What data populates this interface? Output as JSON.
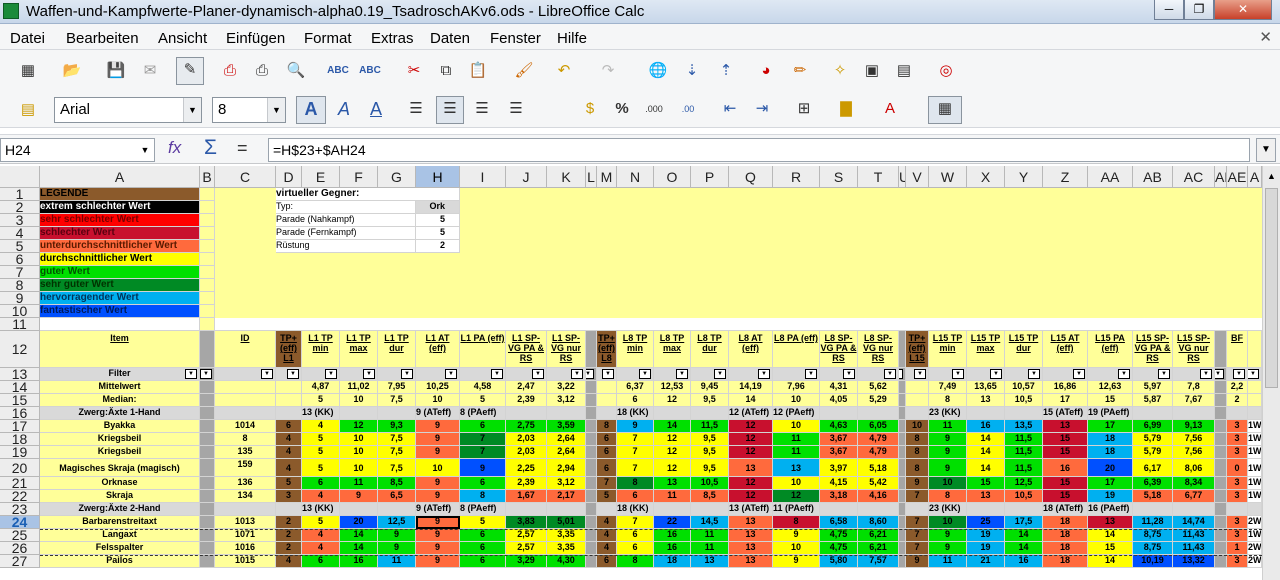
{
  "window": {
    "title": "Waffen-und-Kampfwerte-Planer-dynamisch-alpha0.19_TsadroschAKv6.ods - LibreOffice Calc",
    "min": "─",
    "max": "❐",
    "close": "✕"
  },
  "menu": [
    "Datei",
    "Bearbeiten",
    "Ansicht",
    "Einfügen",
    "Format",
    "Extras",
    "Daten",
    "Fenster",
    "Hilfe"
  ],
  "menu_close": "✕",
  "toolbar1_icons": [
    "new-icon",
    "open-icon",
    "save-icon",
    "email-icon",
    "edit-mode-icon",
    "pdf-icon",
    "print-icon",
    "print-preview-icon",
    "spellcheck-icon",
    "autospell-icon",
    "cut-icon",
    "copy-icon",
    "paste-icon",
    "clone-format-icon",
    "undo-icon",
    "redo-icon",
    "hyperlink-icon",
    "sort-ascending-icon",
    "sort-descending-icon",
    "chart-icon",
    "draw-icon",
    "navigator-icon",
    "gallery-icon",
    "datasource-icon",
    "help-icon"
  ],
  "fmt": {
    "font": "Arial",
    "size": "8"
  },
  "formula": {
    "cell": "H24",
    "content": "=H$23+$AH24"
  },
  "col_headers": [
    "A",
    "B",
    "C",
    "D",
    "E",
    "F",
    "G",
    "H",
    "I",
    "J",
    "K",
    "L",
    "M",
    "N",
    "O",
    "P",
    "Q",
    "R",
    "S",
    "T",
    "U",
    "V",
    "W",
    "X",
    "Y",
    "Z",
    "AA",
    "AB",
    "AC",
    "AD",
    "AE",
    "A"
  ],
  "row_numbers": [
    "1",
    "2",
    "3",
    "4",
    "5",
    "6",
    "7",
    "8",
    "9",
    "10",
    "11",
    "12",
    "13",
    "14",
    "15",
    "16",
    "17",
    "18",
    "19",
    "20",
    "21",
    "22",
    "23",
    "24",
    "25",
    "26",
    "27"
  ],
  "legend": {
    "title": "LEGENDE",
    "items": [
      {
        "label": "extrem schlechter Wert",
        "bg": "#000000",
        "fg": "#ffffff"
      },
      {
        "label": "sehr schlechter Wert",
        "bg": "#ff0000",
        "fg": "#7a0000"
      },
      {
        "label": "schlechter Wert",
        "bg": "#c8102e",
        "fg": "#5a0010"
      },
      {
        "label": "unterdurchschnittlicher Wert",
        "bg": "#ff6a3d",
        "fg": "#5a1a00"
      },
      {
        "label": "durchschnittlicher Wert",
        "bg": "#ffff00",
        "fg": "#000000"
      },
      {
        "label": "guter Wert",
        "bg": "#00e000",
        "fg": "#005500"
      },
      {
        "label": "sehr guter Wert",
        "bg": "#008a24",
        "fg": "#003300"
      },
      {
        "label": "hervorragender Wert",
        "bg": "#00b0f0",
        "fg": "#00335a"
      },
      {
        "label": "fantastischer Wert",
        "bg": "#0050ff",
        "fg": "#001a5a"
      }
    ]
  },
  "opponent": {
    "title": "virtueller Gegner:",
    "rows": [
      [
        "Typ:",
        "Ork"
      ],
      [
        "Parade (Nahkampf)",
        "5"
      ],
      [
        "Parade (Fernkampf)",
        "5"
      ],
      [
        "Rüstung",
        "2"
      ]
    ]
  },
  "col_titles": [
    "Item",
    "",
    "ID",
    "TP+ (eff) L1",
    "L1 TP min",
    "L1 TP max",
    "L1 TP dur",
    "L1 AT (eff)",
    "L1 PA (eff)",
    "L1 SP-VG PA & RS",
    "L1 SP-VG nur RS",
    "",
    "TP+ (eff) L8",
    "L8 TP min",
    "L8 TP max",
    "L8 TP dur",
    "L8 AT (eff)",
    "L8 PA (eff)",
    "L8 SP-VG PA & RS",
    "L8 SP-VG nur RS",
    "",
    "TP+ (eff) L15",
    "L15 TP min",
    "L15 TP max",
    "L15 TP dur",
    "L15 AT (eff)",
    "L15 PA (eff)",
    "L15 SP-VG PA & RS",
    "L15 SP-VG nur RS",
    "",
    "BF",
    ""
  ],
  "filter_label": "Filter",
  "rows": [
    {
      "r": 14,
      "item": "Mittelwert",
      "v": {
        "E": "4,87",
        "F": "11,02",
        "G": "7,95",
        "H": "10,25",
        "I": "4,58",
        "J": "2,47",
        "K": "3,22",
        "N": "6,37",
        "O": "12,53",
        "P": "9,45",
        "Q": "14,19",
        "R": "7,96",
        "S": "4,31",
        "T": "5,62",
        "W": "7,49",
        "X": "13,65",
        "Y": "10,57",
        "Z": "16,86",
        "AA": "12,63",
        "AB": "5,97",
        "AC": "7,8",
        "AE": "2,2"
      }
    },
    {
      "r": 15,
      "item": "Median:",
      "v": {
        "E": "5",
        "F": "10",
        "G": "7,5",
        "H": "10",
        "I": "5",
        "J": "2,39",
        "K": "3,12",
        "N": "6",
        "O": "12",
        "P": "9,5",
        "Q": "14",
        "R": "10",
        "S": "4,05",
        "T": "5,29",
        "W": "8",
        "X": "13",
        "Y": "10,5",
        "Z": "17",
        "AA": "15",
        "AB": "5,87",
        "AC": "7,67",
        "AE": "2"
      }
    },
    {
      "r": 16,
      "group": "Zwerg:Äxte 1-Hand",
      "v": {
        "E": "13 (KK)",
        "H": "9 (ATeff)",
        "I": "8 (PAeff)",
        "N": "18 (KK)",
        "Q": "12 (ATeff)",
        "R": "12 (PAeff)",
        "W": "23 (KK)",
        "Z": "15 (ATeff)",
        "AA": "19 (PAeff)"
      }
    },
    {
      "r": 17,
      "item": "Byakka",
      "id": "1014",
      "v": {
        "D": "6",
        "E": "4",
        "F": "12",
        "G": "9,3",
        "H": "9",
        "I": "6",
        "J": "2,75",
        "K": "3,59",
        "M": "8",
        "N": "9",
        "O": "14",
        "P": "11,5",
        "Q": "12",
        "R": "10",
        "S": "4,63",
        "T": "6,05",
        "V": "10",
        "W": "11",
        "X": "16",
        "Y": "13,5",
        "Z": "13",
        "AA": "17",
        "AB": "6,99",
        "AC": "9,13",
        "AE": "3",
        "AF": "1W"
      }
    },
    {
      "r": 18,
      "item": "Kriegsbeil",
      "id": "8",
      "v": {
        "D": "4",
        "E": "5",
        "F": "10",
        "G": "7,5",
        "H": "9",
        "I": "7",
        "J": "2,03",
        "K": "2,64",
        "M": "6",
        "N": "7",
        "O": "12",
        "P": "9,5",
        "Q": "12",
        "R": "11",
        "S": "3,67",
        "T": "4,79",
        "V": "8",
        "W": "9",
        "X": "14",
        "Y": "11,5",
        "Z": "15",
        "AA": "18",
        "AB": "5,79",
        "AC": "7,56",
        "AE": "3",
        "AF": "1W"
      }
    },
    {
      "r": 19,
      "item": "Kriegsbeil",
      "id": "135",
      "v": {
        "D": "4",
        "E": "5",
        "F": "10",
        "G": "7,5",
        "H": "9",
        "I": "7",
        "J": "2,03",
        "K": "2,64",
        "M": "6",
        "N": "7",
        "O": "12",
        "P": "9,5",
        "Q": "12",
        "R": "11",
        "S": "3,67",
        "T": "4,79",
        "V": "8",
        "W": "9",
        "X": "14",
        "Y": "11,5",
        "Z": "15",
        "AA": "18",
        "AB": "5,79",
        "AC": "7,56",
        "AE": "3",
        "AF": "1W"
      }
    },
    {
      "r": 20,
      "item": "Magisches Skraja (magisch)",
      "id": "159",
      "v": {
        "D": "4",
        "E": "5",
        "F": "10",
        "G": "7,5",
        "H": "10",
        "I": "9",
        "J": "2,25",
        "K": "2,94",
        "M": "6",
        "N": "7",
        "O": "12",
        "P": "9,5",
        "Q": "13",
        "R": "13",
        "S": "3,97",
        "T": "5,18",
        "V": "8",
        "W": "9",
        "X": "14",
        "Y": "11,5",
        "Z": "16",
        "AA": "20",
        "AB": "6,17",
        "AC": "8,06",
        "AE": "0",
        "AF": "1W"
      }
    },
    {
      "r": 21,
      "item": "Orknase",
      "id": "136",
      "v": {
        "D": "5",
        "E": "6",
        "F": "11",
        "G": "8,5",
        "H": "9",
        "I": "6",
        "J": "2,39",
        "K": "3,12",
        "M": "7",
        "N": "8",
        "O": "13",
        "P": "10,5",
        "Q": "12",
        "R": "10",
        "S": "4,15",
        "T": "5,42",
        "V": "9",
        "W": "10",
        "X": "15",
        "Y": "12,5",
        "Z": "15",
        "AA": "17",
        "AB": "6,39",
        "AC": "8,34",
        "AE": "3",
        "AF": "1W"
      }
    },
    {
      "r": 22,
      "item": "Skraja",
      "id": "134",
      "v": {
        "D": "3",
        "E": "4",
        "F": "9",
        "G": "6,5",
        "H": "9",
        "I": "8",
        "J": "1,67",
        "K": "2,17",
        "M": "5",
        "N": "6",
        "O": "11",
        "P": "8,5",
        "Q": "12",
        "R": "12",
        "S": "3,18",
        "T": "4,16",
        "V": "7",
        "W": "8",
        "X": "13",
        "Y": "10,5",
        "Z": "15",
        "AA": "19",
        "AB": "5,18",
        "AC": "6,77",
        "AE": "3",
        "AF": "1W"
      }
    },
    {
      "r": 23,
      "group": "Zwerg:Äxte 2-Hand",
      "v": {
        "E": "13 (KK)",
        "H": "9 (ATeff)",
        "I": "8 (PAeff)",
        "N": "18 (KK)",
        "Q": "13 (ATeff)",
        "R": "11 (PAeff)",
        "W": "23 (KK)",
        "Z": "18 (ATeff)",
        "AA": "16 (PAeff)"
      }
    },
    {
      "r": 24,
      "item": "Barbarenstreitaxt",
      "id": "1013",
      "v": {
        "D": "2",
        "E": "5",
        "F": "20",
        "G": "12,5",
        "H": "9",
        "I": "5",
        "J": "3,83",
        "K": "5,01",
        "M": "4",
        "N": "7",
        "O": "22",
        "P": "14,5",
        "Q": "13",
        "R": "8",
        "S": "6,58",
        "T": "8,60",
        "V": "7",
        "W": "10",
        "X": "25",
        "Y": "17,5",
        "Z": "18",
        "AA": "13",
        "AB": "11,28",
        "AC": "14,74",
        "AE": "3",
        "AF": "2W"
      }
    },
    {
      "r": 25,
      "item": "Langaxt",
      "id": "1071",
      "v": {
        "D": "2",
        "E": "4",
        "F": "14",
        "G": "9",
        "H": "9",
        "I": "6",
        "J": "2,57",
        "K": "3,35",
        "M": "4",
        "N": "6",
        "O": "16",
        "P": "11",
        "Q": "13",
        "R": "9",
        "S": "4,75",
        "T": "6,21",
        "V": "7",
        "W": "9",
        "X": "19",
        "Y": "14",
        "Z": "18",
        "AA": "14",
        "AB": "8,75",
        "AC": "11,43",
        "AE": "3",
        "AF": "1W"
      }
    },
    {
      "r": 26,
      "item": "Felsspalter",
      "id": "1016",
      "v": {
        "D": "2",
        "E": "4",
        "F": "14",
        "G": "9",
        "H": "9",
        "I": "6",
        "J": "2,57",
        "K": "3,35",
        "M": "4",
        "N": "6",
        "O": "16",
        "P": "11",
        "Q": "13",
        "R": "10",
        "S": "4,75",
        "T": "6,21",
        "V": "7",
        "W": "9",
        "X": "19",
        "Y": "14",
        "Z": "18",
        "AA": "15",
        "AB": "8,75",
        "AC": "11,43",
        "AE": "1",
        "AF": "2W"
      }
    },
    {
      "r": 27,
      "item": "Pailos",
      "id": "1015",
      "v": {
        "D": "4",
        "E": "6",
        "F": "16",
        "G": "11",
        "H": "9",
        "I": "6",
        "J": "3,29",
        "K": "4,30",
        "M": "6",
        "N": "8",
        "O": "18",
        "P": "13",
        "Q": "13",
        "R": "9",
        "S": "5,80",
        "T": "7,57",
        "V": "9",
        "W": "11",
        "X": "21",
        "Y": "16",
        "Z": "18",
        "AA": "14",
        "AB": "10,19",
        "AC": "13,32",
        "AE": "3",
        "AF": "2W"
      }
    }
  ]
}
